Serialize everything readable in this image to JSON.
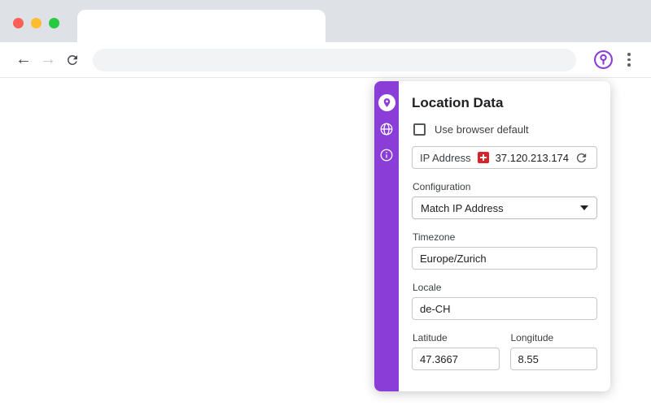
{
  "colors": {
    "accent_purple": "#8b3dd8",
    "flag_red": "#d8232a",
    "traffic_red": "#ff5f57",
    "traffic_yellow": "#febc2e",
    "traffic_green": "#28c840"
  },
  "browser": {
    "address_value": "",
    "address_placeholder": ""
  },
  "panel": {
    "title": "Location Data",
    "checkbox": {
      "label": "Use browser default",
      "checked": false
    },
    "ip": {
      "label": "IP Address",
      "value": "37.120.213.174",
      "flag": "switzerland"
    },
    "configuration": {
      "label": "Configuration",
      "value": "Match IP Address"
    },
    "timezone": {
      "label": "Timezone",
      "value": "Europe/Zurich"
    },
    "locale": {
      "label": "Locale",
      "value": "de-CH"
    },
    "latitude": {
      "label": "Latitude",
      "value": "47.3667"
    },
    "longitude": {
      "label": "Longitude",
      "value": "8.55"
    },
    "sidebar_icons": [
      "location-pin",
      "globe",
      "info"
    ]
  }
}
